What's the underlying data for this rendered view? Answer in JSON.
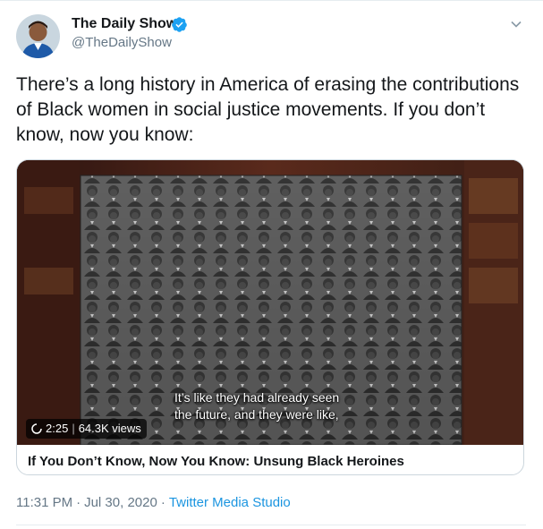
{
  "author": {
    "name": "The Daily Show",
    "handle": "@TheDailyShow",
    "verified": true
  },
  "tweet": {
    "text": "There’s a long history in America of erasing the contributions of Black women in social justice movements. If you don’t know, now you know:"
  },
  "media": {
    "duration": "2:25",
    "views": "64.3K views",
    "subtitle_line1": "It’s like they had already seen",
    "subtitle_line2": "the future, and they were like,",
    "card_title": "If You Don’t Know, Now You Know: Unsung Black Heroines"
  },
  "meta": {
    "time": "11:31 PM",
    "separator": "·",
    "date": "Jul 30, 2020",
    "source": "Twitter Media Studio"
  },
  "colors": {
    "accent": "#1b95e0",
    "text": "#14171a",
    "secondary": "#657786"
  },
  "icons": {
    "verified": "verified-badge-icon",
    "menu": "chevron-down-icon",
    "loading": "loading-spinner-icon"
  }
}
